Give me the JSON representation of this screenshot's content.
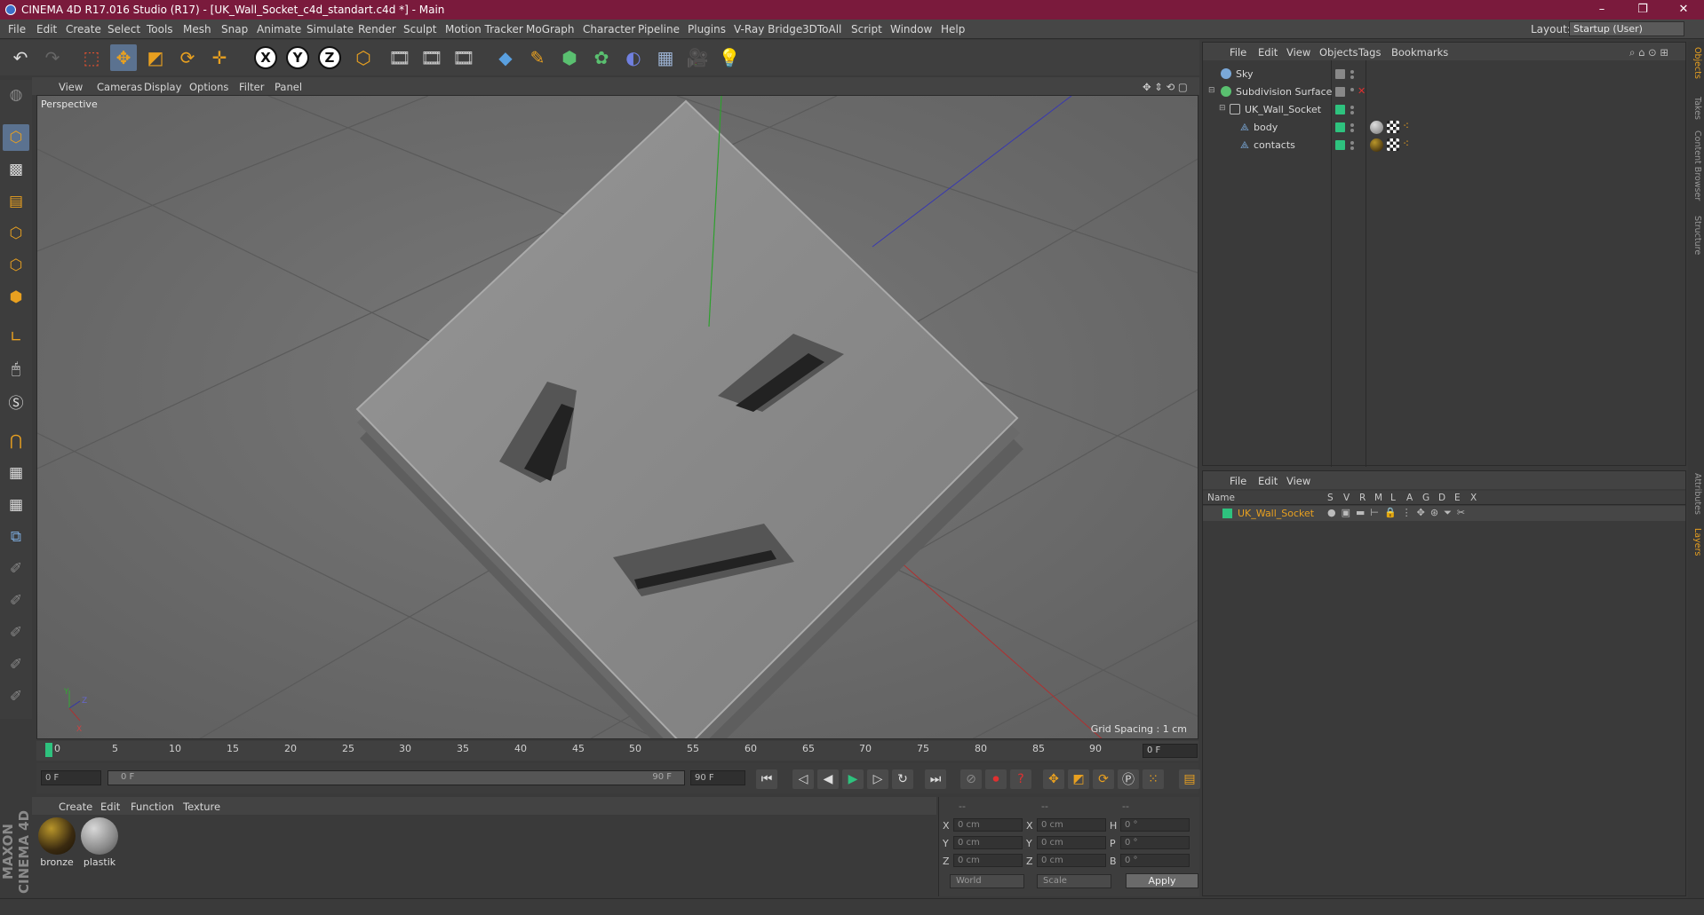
{
  "titlebar": {
    "title": "CINEMA 4D R17.016 Studio (R17) - [UK_Wall_Socket_c4d_standart.c4d *] - Main",
    "minimize": "–",
    "maximize": "❐",
    "close": "✕"
  },
  "menubar": {
    "items": [
      "File",
      "Edit",
      "Create",
      "Select",
      "Tools",
      "Mesh",
      "Snap",
      "Animate",
      "Simulate",
      "Render",
      "Sculpt",
      "Motion Tracker",
      "MoGraph",
      "Character",
      "Pipeline",
      "Plugins",
      "V-Ray Bridge",
      "3DToAll",
      "Script",
      "Window",
      "Help"
    ],
    "layout_label": "Layout:",
    "layout_value": "Startup (User)"
  },
  "toolbar": {
    "axis_x": "X",
    "axis_y": "Y",
    "axis_z": "Z"
  },
  "viewport": {
    "menu": [
      "View",
      "Cameras",
      "Display",
      "Options",
      "Filter",
      "Panel"
    ],
    "label": "Perspective",
    "grid_spacing": "Grid Spacing : 1 cm"
  },
  "timeline": {
    "ticks": [
      "0",
      "5",
      "10",
      "15",
      "20",
      "25",
      "30",
      "35",
      "40",
      "45",
      "50",
      "55",
      "60",
      "65",
      "70",
      "75",
      "80",
      "85",
      "90"
    ],
    "current_frame": "0 F",
    "start_field": "0 F",
    "range_start": "0 F",
    "range_end": "90 F",
    "end_field": "90 F"
  },
  "materials": {
    "menu": [
      "Create",
      "Edit",
      "Function",
      "Texture"
    ],
    "items": [
      {
        "name": "bronze",
        "color": "#3a2a10"
      },
      {
        "name": "plastik",
        "color": "#8a8a8a"
      }
    ]
  },
  "coordinates": {
    "header": [
      "--",
      "--",
      "--"
    ],
    "rows": [
      {
        "a": "X",
        "v1": "0 cm",
        "b": "X",
        "v2": "0 cm",
        "c": "H",
        "v3": "0 °"
      },
      {
        "a": "Y",
        "v1": "0 cm",
        "b": "Y",
        "v2": "0 cm",
        "c": "P",
        "v3": "0 °"
      },
      {
        "a": "Z",
        "v1": "0 cm",
        "b": "Z",
        "v2": "0 cm",
        "c": "B",
        "v3": "0 °"
      }
    ],
    "mode1": "World",
    "mode2": "Scale",
    "apply": "Apply"
  },
  "objects": {
    "menu": [
      "File",
      "Edit",
      "View",
      "Objects",
      "Tags",
      "Bookmarks"
    ],
    "rows": [
      {
        "name": "Sky"
      },
      {
        "name": "Subdivision Surface"
      },
      {
        "name": "UK_Wall_Socket"
      },
      {
        "name": "body"
      },
      {
        "name": "contacts"
      }
    ]
  },
  "layers": {
    "menu": [
      "File",
      "Edit",
      "View"
    ],
    "columns": [
      "Name",
      "S",
      "V",
      "R",
      "M",
      "L",
      "A",
      "G",
      "D",
      "E",
      "X"
    ],
    "row_name": "UK_Wall_Socket",
    "row_color": "#2ec27e"
  },
  "right_tabs": [
    "Objects",
    "Takes",
    "Content Browser",
    "Structure",
    "Attributes",
    "Layers"
  ],
  "colors": {
    "title_bg": "#7a1a3c",
    "accent": "#e8a020",
    "selected": "#5b7290",
    "layer_name": "#e8a020"
  }
}
